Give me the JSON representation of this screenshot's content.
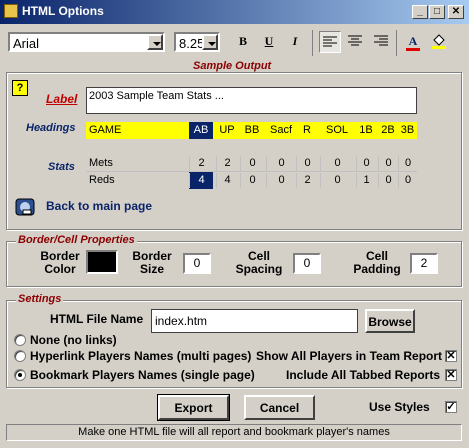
{
  "window": {
    "title": "HTML Options"
  },
  "toolbar": {
    "font_name": "Arial",
    "font_size": "8.25",
    "bold": "B",
    "underline": "U",
    "italic": "I",
    "font_color": "A"
  },
  "sample": {
    "title": "Sample Output",
    "label_caption": "Label",
    "label_value": "2003 Sample Team Stats ...",
    "headings_caption": "Headings",
    "stats_caption": "Stats",
    "headings": [
      "GAME",
      "AB",
      "UP",
      "BB",
      "Sacf",
      "R",
      "SOL",
      "1B",
      "2B",
      "3B"
    ],
    "rows": [
      {
        "team": "Mets",
        "values": [
          "2",
          "2",
          "0",
          "0",
          "0",
          "0",
          "0",
          "0",
          "0"
        ]
      },
      {
        "team": "Reds",
        "values": [
          "4",
          "4",
          "0",
          "0",
          "2",
          "0",
          "1",
          "0",
          "0"
        ]
      }
    ],
    "back_link": "Back to main page"
  },
  "border_group": {
    "title": "Border/Cell Properties",
    "border_color_label1": "Border",
    "border_color_label2": "Color",
    "border_size_label1": "Border",
    "border_size_label2": "Size",
    "border_size": "0",
    "cell_spacing_label1": "Cell",
    "cell_spacing_label2": "Spacing",
    "cell_spacing": "0",
    "cell_padding_label1": "Cell",
    "cell_padding_label2": "Padding",
    "cell_padding": "2"
  },
  "settings": {
    "title": "Settings",
    "file_label": "HTML File Name",
    "file_value": "index.htm",
    "browse": "Browse",
    "radio_none": "None (no links)",
    "radio_hyperlink": "Hyperlink Players Names (multi pages)",
    "radio_bookmark": "Bookmark Players Names (single page)",
    "show_all": "Show All Players in Team Report",
    "include_all": "Include All Tabbed Reports"
  },
  "footer": {
    "export": "Export",
    "cancel": "Cancel",
    "use_styles": "Use Styles",
    "status": "Make one HTML file will all report and bookmark player's names"
  },
  "colors": {
    "headings_bg": "#ffff00",
    "ab_highlight": "#0a246a",
    "border_color": "#000000"
  }
}
